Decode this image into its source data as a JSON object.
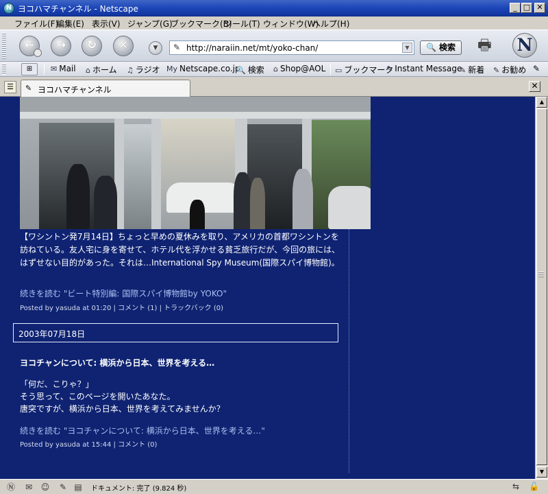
{
  "window": {
    "title": "ヨコハマチャンネル - Netscape",
    "app_icon": "N",
    "minimize": "_",
    "maximize": "□",
    "close": "✕"
  },
  "menu": [
    "ファイル(F)",
    "編集(E)",
    "表示(V)",
    "ジャンプ(G)",
    "ブックマーク(B)",
    "ツール(T)",
    "ウィンドウ(W)",
    "ヘルプ(H)"
  ],
  "nav": {
    "back": "←",
    "forward": "→",
    "reload": "↻",
    "stop": "✕",
    "url": "http://naraiin.net/mt/yoko-chan/",
    "search_label": "🔍 検索",
    "logo": "N"
  },
  "personal_toolbar": [
    {
      "icon": "✉",
      "label": "Mail"
    },
    {
      "icon": "⌂",
      "label": "ホーム"
    },
    {
      "icon": "♫",
      "label": "ラジオ"
    },
    {
      "icon": "My",
      "label": "Netscape.co.jp"
    },
    {
      "icon": "🔍",
      "label": "検索"
    },
    {
      "icon": "⌂",
      "label": "Shop@AOL"
    },
    {
      "icon": "▭",
      "label": "ブックマーク"
    },
    {
      "icon": "✎",
      "label": "Instant Message"
    },
    {
      "icon": "✎",
      "label": "新着"
    },
    {
      "icon": "✎",
      "label": "お勧め"
    }
  ],
  "tabs": {
    "active_label": "ヨコハマチャンネル",
    "close": "✕"
  },
  "article1": {
    "body": "【ワシントン発7月14日】ちょっと早めの夏休みを取り、アメリカの首都ワシントンを訪ねている。友人宅に身を寄せて、ホテル代を浮かせる貧乏旅行だが、今回の旅には、はずせない目的があった。それは…International Spy Museum(国際スパイ博物館)。",
    "more": "続きを読む \"ビート特別編: 国際スパイ博物館by YOKO\"",
    "posted_prefix": "Posted by yasuda at 01:20",
    "comment": "コメント (1)",
    "trackback": "トラックバック (0)"
  },
  "date_header": "2003年07月18日",
  "article2": {
    "title": "ヨコチャンについて: 横浜から日本、世界を考える…",
    "line1": "「何だ、こりゃ？」",
    "line2": "そう思って、このページを開いたあなた。",
    "line3": "唐突ですが、横浜から日本、世界を考えてみませんか？",
    "more": "続きを読む \"ヨコチャンについて: 横浜から日本、世界を考える…\"",
    "posted_prefix": "Posted by yasuda at 15:44",
    "comment": "コメント (0)"
  },
  "status": {
    "text": "ドキュメント: 完了 (9.824 秒)"
  }
}
